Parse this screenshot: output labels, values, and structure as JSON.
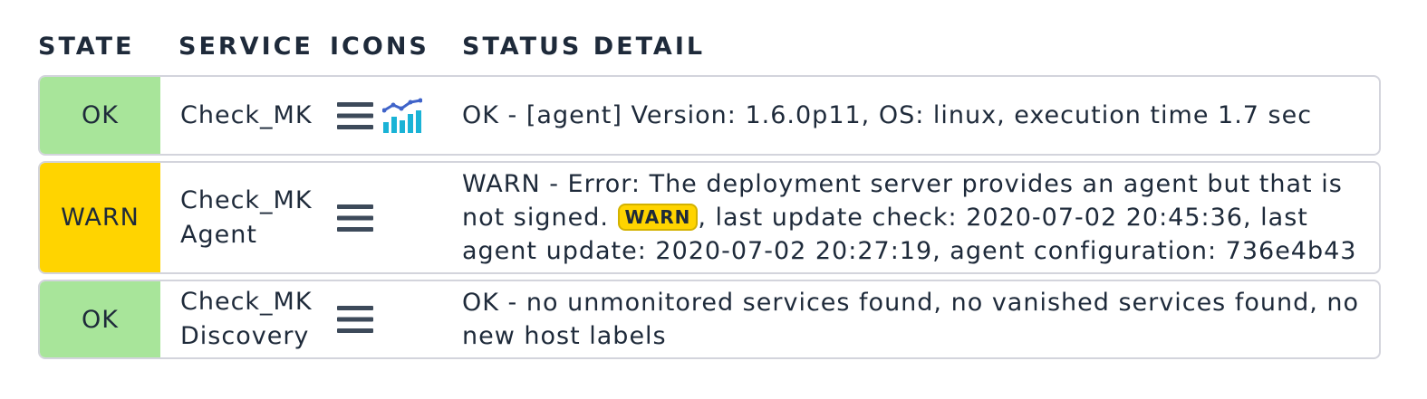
{
  "headers": {
    "state": "STATE",
    "service": "SERVICE",
    "icons": "ICONS",
    "status_detail": "STATUS DETAIL"
  },
  "colors": {
    "ok": "#a8e59a",
    "warn": "#ffd400",
    "text": "#1e2a3a",
    "row_border": "#d3d4dc"
  },
  "rows": [
    {
      "state": "OK",
      "service_line1": "Check_MK",
      "service_line2": "",
      "icons": [
        "menu-icon",
        "graph-icon"
      ],
      "detail": "OK - [agent] Version: 1.6.0p11, OS: linux, execution time 1.7 sec"
    },
    {
      "state": "WARN",
      "service_line1": "Check_MK",
      "service_line2": "Agent",
      "icons": [
        "menu-icon"
      ],
      "detail_before": "WARN - Error: The deployment server provides an agent but that is not signed. ",
      "detail_badge": "WARN",
      "detail_after": ", last update check: 2020-07-02 20:45:36, last agent update: 2020-07-02 20:27:19, agent configuration: 736e4b43"
    },
    {
      "state": "OK",
      "service_line1": "Check_MK",
      "service_line2": "Discovery",
      "icons": [
        "menu-icon"
      ],
      "detail": "OK - no unmonitored services found, no vanished services found, no new host labels"
    }
  ]
}
